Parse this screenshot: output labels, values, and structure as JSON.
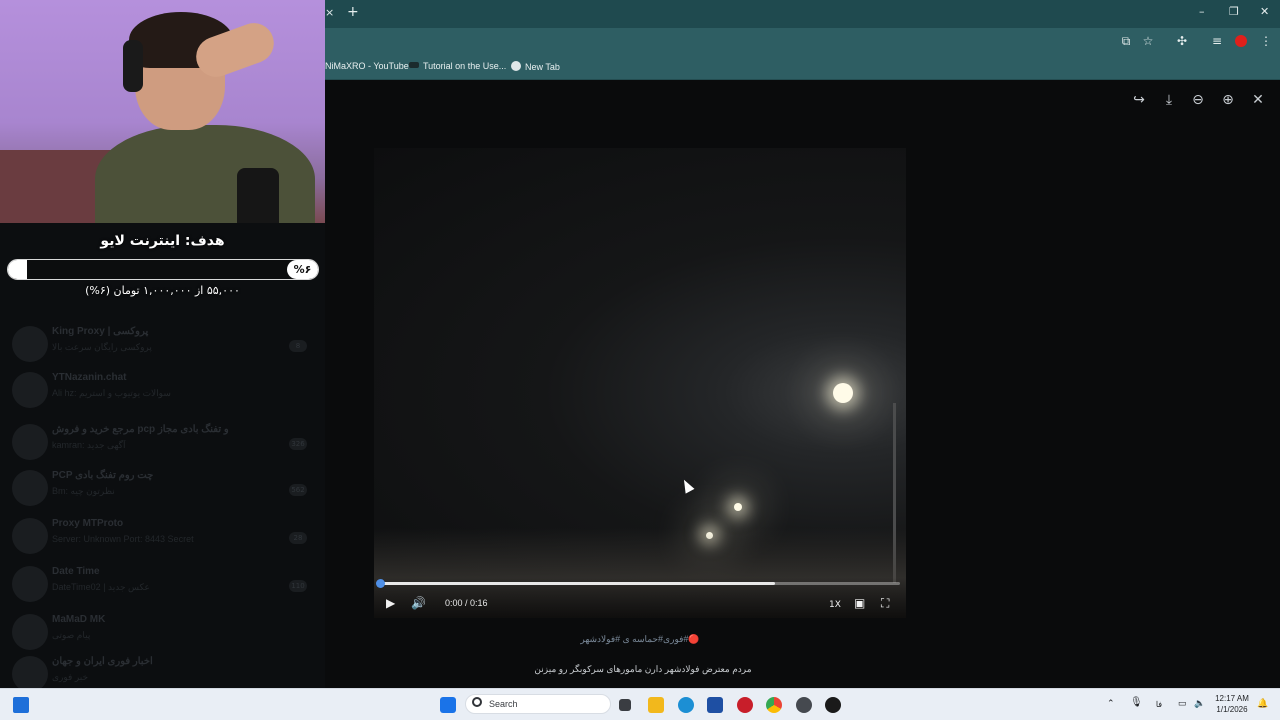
{
  "browser": {
    "tab_close_glyph": "×",
    "new_tab_glyph": "+",
    "window_controls": {
      "minimize": "–",
      "restore": "❐",
      "close": "✕"
    },
    "bookmarks": [
      {
        "label": "NiMaXRO - YouTube",
        "icon_color": "#ff0000"
      },
      {
        "label": "Tutorial on the Use...",
        "icon_color": "#1b2b2d"
      },
      {
        "label": "New Tab",
        "icon_color": "#dfe7e8"
      }
    ]
  },
  "telegram": {
    "chats": [
      {
        "name": "King Proxy | پروکسی",
        "preview": "پروکسی رایگان سرعت بالا",
        "count": "8"
      },
      {
        "name": "YTNazanin.chat",
        "preview": "Ali hz: سوالات یوتیوب و استریم",
        "count": ""
      },
      {
        "name": "مرجع خرید و فروش pcp و تفنگ بادی مجاز",
        "preview": "kamran: آگهی جدید",
        "count": "326"
      },
      {
        "name": "PCP چت روم تفنگ بادی",
        "preview": "Bm: نظرتون چیه",
        "count": "562"
      },
      {
        "name": "Proxy MTProto",
        "preview": "Server: Unknown Port: 8443 Secret",
        "count": "28"
      },
      {
        "name": "Date Time",
        "preview": "DateTime02 | عکس جدید",
        "count": "110"
      },
      {
        "name": "MaMaD MK",
        "preview": "پیام صوتی",
        "count": ""
      },
      {
        "name": "اخبار فوری ایران و جهان",
        "preview": "خبر فوری",
        "count": ""
      }
    ]
  },
  "video": {
    "time": "0:00 / 0:16",
    "progress": 0.0,
    "buffered": 0.76,
    "speed": "1X",
    "icons": {
      "play": "play-icon",
      "volume": "volume-icon",
      "pip": "pip-icon",
      "fullscreen": "fullscreen-icon"
    }
  },
  "caption": {
    "hashtags": "🔴#فوری#حماسه ی #فولادشهر",
    "text": "مردم معترض فولادشهر دارن مامورهای سرکوبگر رو میزنن"
  },
  "goal": {
    "title": "هدف: اینترنت لایو",
    "percent_label": "%۶",
    "percent": 0.06,
    "amount": "۵۵,۰۰۰ از ۱,۰۰۰,۰۰۰ تومان (۶%)"
  },
  "taskbar": {
    "search_placeholder": "Search",
    "lang": "فا",
    "time": "12:17 AM",
    "date": "1/1/2026"
  },
  "colors": {
    "browser_frame": "#1f4a4f",
    "browser_toolbar": "#2e5e63",
    "accent_blue": "#4f8fe6",
    "taskbar": "#e9eef5"
  }
}
